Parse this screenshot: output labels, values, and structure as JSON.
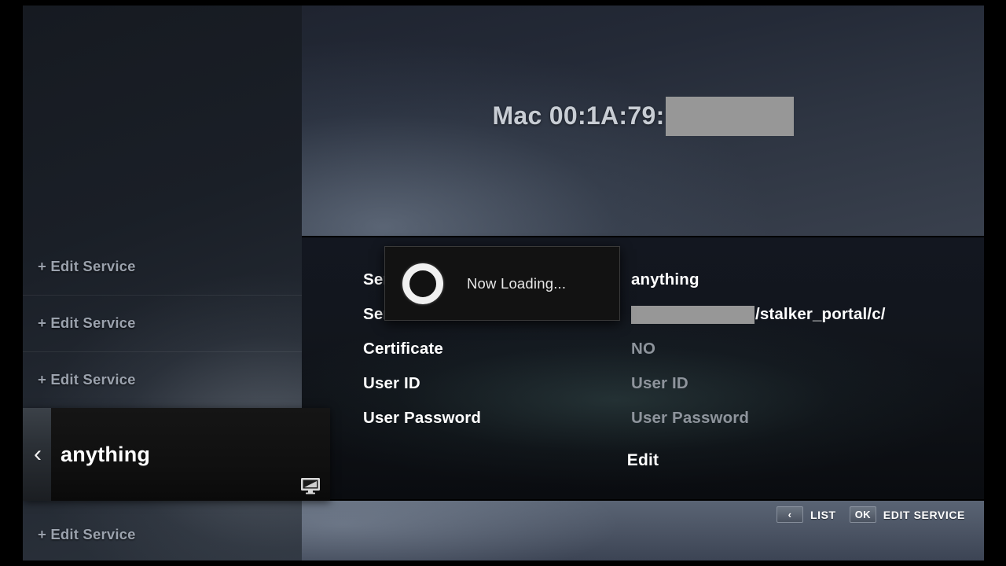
{
  "header": {
    "mac_label": "Mac 00:1A:79:",
    "mac_redacted": ""
  },
  "sidebar": {
    "items_top": [
      {
        "label": "+ Edit Service"
      },
      {
        "label": "+ Edit Service"
      },
      {
        "label": "+ Edit Service"
      }
    ],
    "items_bottom": [
      {
        "label": "+ Edit Service"
      }
    ],
    "selected": {
      "label": "anything",
      "back_icon": "‹",
      "device_icon": "monitor-icon"
    }
  },
  "form": {
    "rows": [
      {
        "label": "Service Name",
        "value": "anything",
        "value_style": "bright",
        "redacted": false
      },
      {
        "label": "Server URL",
        "value": "/stalker_portal/c/",
        "value_style": "bright",
        "redacted": true
      },
      {
        "label": "Certificate",
        "value": "NO",
        "value_style": "dim",
        "redacted": false
      },
      {
        "label": "User ID",
        "value": "User ID",
        "value_style": "dim",
        "redacted": false
      },
      {
        "label": "User Password",
        "value": "User Password",
        "value_style": "dim",
        "redacted": false
      }
    ],
    "edit_label": "Edit"
  },
  "dialog": {
    "text": "Now Loading...",
    "spinner_icon": "spinner-ring-icon"
  },
  "footer": {
    "hints": [
      {
        "key": "‹",
        "label": "LIST"
      },
      {
        "key": "OK",
        "label": "EDIT SERVICE"
      }
    ]
  },
  "colors": {
    "accent_white": "#ffffff",
    "dim_text": "#8e949c",
    "redaction": "#979797",
    "footer_bar": "#4d5666"
  }
}
